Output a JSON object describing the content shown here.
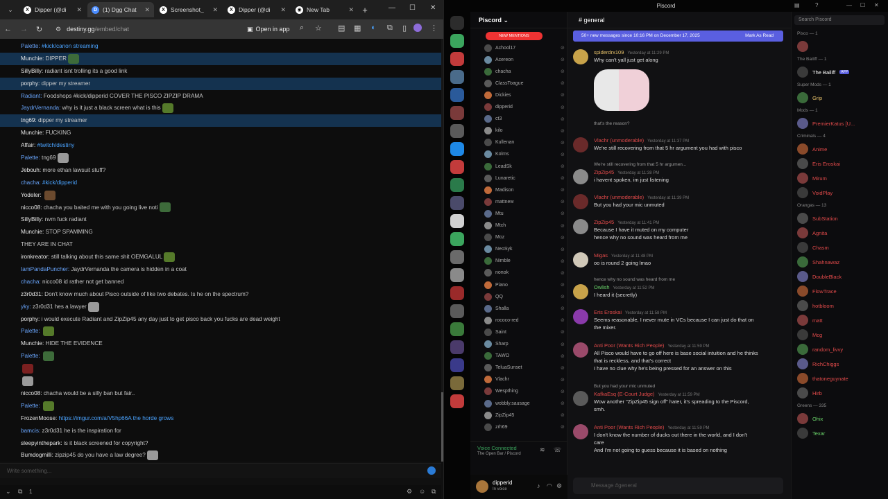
{
  "browser": {
    "tabs": [
      {
        "label": "Dipper (@di",
        "icon": "x-icon"
      },
      {
        "label": "(1) Dgg Chat",
        "icon": "dgg-icon"
      },
      {
        "label": "Screenshot_",
        "icon": "x-icon"
      },
      {
        "label": "Dipper (@di",
        "icon": "x-icon"
      },
      {
        "label": "New Tab",
        "icon": "globe-icon"
      }
    ],
    "url_host": "destiny.gg",
    "url_path": "/embed/chat",
    "open_in_app": "Open in app"
  },
  "chat": {
    "messages": [
      {
        "user": "Palette:",
        "text": "#kick/canon streaming",
        "link": true,
        "hl": false,
        "blue": true
      },
      {
        "user": "Munchie:",
        "text": "DIPPER",
        "hl": true
      },
      {
        "user": "SillyBilly:",
        "text": "radiant isnt trolling its a good link",
        "hl": false
      },
      {
        "user": "porphy:",
        "text": "dipper my streamer",
        "hl": true
      },
      {
        "user": "Radiant:",
        "text": "Foodshops #kick/dipperid COVER THE PISCO ZIPZIP DRAMA",
        "hl": false,
        "blue": true
      },
      {
        "user": "JaydrVernanda:",
        "text": "why is it just a black screen what is this",
        "hl": false,
        "blue": true
      },
      {
        "user": "tng69:",
        "text": "dipper my streamer",
        "hl": true
      },
      {
        "user": "Munchie:",
        "text": "FUCKING",
        "hl": false
      },
      {
        "user": "Affair:",
        "text": "#twitch/destiny",
        "hl": false,
        "link": true
      },
      {
        "user": "Palette:",
        "text": "tng69",
        "hl": false,
        "blue": true
      },
      {
        "user": "Jebouh:",
        "text": "more ethan lawsuit stuff?",
        "hl": false
      },
      {
        "user": "chacha:",
        "text": "#kick/dipperid",
        "hl": false,
        "link": true,
        "blue": true
      },
      {
        "user": "Yodeler:",
        "text": "",
        "hl": false
      },
      {
        "user": "nicco08:",
        "text": "chacha  you baited me with you going live noti",
        "hl": false
      },
      {
        "user": "SillyBilly:",
        "text": "nvm fuck radiant",
        "hl": false
      },
      {
        "user": "Munchie:",
        "text": "STOP SPAMMING",
        "hl": false
      },
      {
        "user": "",
        "text": "THEY ARE IN CHAT",
        "hl": false
      },
      {
        "user": "ironkreator:",
        "text": "still talking about this same shit OEMGALUL",
        "hl": false
      },
      {
        "user": "IamPandaPuncher:",
        "text": "JaydrVernanda the camera is hidden in a coat",
        "hl": false,
        "blue": true
      },
      {
        "user": "chacha:",
        "text": "nicco08 id rather not get banned",
        "hl": false,
        "blue": true
      },
      {
        "user": "z3r0d31:",
        "text": "Don't know much about Pisco outside of like two debates. Is he on the spectrum?",
        "hl": false
      },
      {
        "user": "yky:",
        "text": "z3r0d31 hes a lawyer",
        "hl": false,
        "blue": true
      },
      {
        "user": "porphy:",
        "text": "i would execute Radiant and ZipZip45 any day just to get pisco back you fucks are dead weight",
        "hl": false
      },
      {
        "user": "Palette:",
        "text": "",
        "hl": false,
        "blue": true
      },
      {
        "user": "Munchie:",
        "text": "HIDE THE EVIDENCE",
        "hl": false
      },
      {
        "user": "Palette:",
        "text": "",
        "hl": false,
        "blue": true
      },
      {
        "user": "",
        "text": "",
        "hl": false
      },
      {
        "user": "",
        "text": "",
        "hl": false
      },
      {
        "user": "nicco08:",
        "text": "chacha  would be a silly ban but fair..",
        "hl": false
      },
      {
        "user": "Palette:",
        "text": "",
        "hl": false,
        "blue": true
      },
      {
        "user": "FrozenMoose:",
        "text": "https://imgur.com/a/V5hp66A the horde grows",
        "hl": false,
        "link": true
      },
      {
        "user": "bamcis:",
        "text": "z3r0d31 he is the inspiration for",
        "hl": false,
        "blue": true
      },
      {
        "user": "sleepyinthepark:",
        "text": "is it black screened for copyright?",
        "hl": false
      },
      {
        "user": "Bumdogmilli:",
        "text": "zipzip45 do you have a law degree?",
        "hl": false
      }
    ],
    "input_placeholder": "Write something...",
    "footer_count": "1"
  },
  "discord": {
    "window_title": "Piscord",
    "server_name": "Piscord",
    "channel": "general",
    "new_messages": "50+ new messages since 10:16 PM on December 17, 2025",
    "mark_as_read": "Mark As Read",
    "voice_members": [
      "Achool17",
      "Acereon",
      "chacha",
      "ClassToague",
      "Dickies",
      "dipperid",
      "ct3",
      "kilo",
      "Kullenan",
      "Kolms",
      "LeadSk",
      "Lunaretic",
      "Madison",
      "mattnew",
      "Mtu",
      "Mtch",
      "Moz",
      "NeoSyk",
      "Nimble",
      "nonok",
      "Piano",
      "QQ",
      "Shalla",
      "rococo-red",
      "Saint",
      "Sharp",
      "TAWO",
      "TeluaSunset",
      "Vlachr",
      "Wespthing",
      "wobbly.sausage",
      "ZipZip45",
      "zrh69"
    ],
    "voice_status": "Voice Connected",
    "voice_channel": "The Open Bar / Piscord",
    "username": "dipperid",
    "user_status": "In voice",
    "composer_placeholder": "Message #general",
    "member_search": "Search Piscord",
    "messages": [
      {
        "name": "spiderdrx109",
        "time": "Yesterday at 11:29 PM",
        "text": "Why can't yall just get along",
        "color": "#e8c36b"
      },
      {
        "name": "",
        "time": "",
        "text": "",
        "reply": "that's the reason?",
        "color": "#e24a4a"
      },
      {
        "name": "Vlachr (unmoderable)",
        "time": "Yesterday at 11:37 PM",
        "text": "We're still recovering from that 5 hr argument you had with pisco",
        "color": "#e24a4a"
      },
      {
        "name": "ZipZip45",
        "time": "Yesterday at 11:38 PM",
        "text": "i havent spoken, im just listening",
        "reply": "We're still recovering from that 5 hr argumen...",
        "color": "#e24a4a"
      },
      {
        "name": "Vlachr (unmoderable)",
        "time": "Yesterday at 11:39 PM",
        "text": "But you had your mic unmuted",
        "color": "#e24a4a"
      },
      {
        "name": "ZipZip45",
        "time": "Yesterday at 11:41 PM",
        "text": "Because I have it muted on my computer",
        "text2": "hence why no sound was heard from me",
        "color": "#e24a4a"
      },
      {
        "name": "Migas",
        "time": "Yesterday at 11:48 PM",
        "text": "oo is round 2 going lmao",
        "color": "#e24a4a"
      },
      {
        "name": "Owlish",
        "time": "Yesterday at 11:52 PM",
        "text": "I heard it (secretly)",
        "reply": "hence why no sound was heard from me",
        "color": "#6ad46a"
      },
      {
        "name": "Eris Eroskai",
        "time": "Yesterday at 11:58 PM",
        "text": "Seems reasonable, I never mute in VCs because I can just do that on",
        "text2": "the mixer.",
        "color": "#e24a4a"
      },
      {
        "name": "Anti Poor (Wants Rich People)",
        "time": "Yesterday at 11:59 PM",
        "text": "All Pisco would have to go off here is base social intuition and he thinks",
        "text2": "that is reckless, and that's correct",
        "text3": "I have no clue why he's being pressed for an answer on this",
        "color": "#e24a4a"
      },
      {
        "name": "KafkaEsq (E-Court Judge)",
        "time": "Yesterday at 11:59 PM",
        "text": "Wow another \"ZipZip45 sign off\" hater, it's spreading to the Piscord,",
        "text2": "smh.",
        "reply": "But you had your mic unmuted",
        "color": "#e24a4a"
      },
      {
        "name": "Anti Poor (Wants Rich People)",
        "time": "Yesterday at 11:59 PM",
        "text": "I don't know the number of ducks out there in the world, and I don't",
        "text2": "care",
        "text3": "And I'm not going to guess because it is based on nothing",
        "color": "#e24a4a"
      }
    ],
    "member_groups": [
      {
        "title": "Pisco — 1",
        "members": [
          {
            "name": "",
            "color": "#e24a4a"
          }
        ]
      },
      {
        "title": "The Bailiff — 1",
        "members": [
          {
            "name": "The Bailiff",
            "color": "#ffffff",
            "badge": "APP"
          }
        ]
      },
      {
        "title": "Super Mods — 1",
        "members": [
          {
            "name": "Grip",
            "color": "#e8c36b"
          }
        ]
      },
      {
        "title": "Mods — 1",
        "members": [
          {
            "name": "PremierKatus [U...",
            "color": "#e24a4a"
          }
        ]
      },
      {
        "title": "Criminals — 4",
        "members": [
          {
            "name": "Anime",
            "color": "#e24a4a"
          },
          {
            "name": "Eris Eroskai",
            "color": "#e24a4a"
          },
          {
            "name": "Mirum",
            "color": "#e24a4a"
          },
          {
            "name": "VoidPlay",
            "color": "#e24a4a"
          }
        ]
      },
      {
        "title": "Orangas — 13",
        "members": [
          {
            "name": "SubStation",
            "color": "#e24a4a"
          },
          {
            "name": "Agnita",
            "color": "#e24a4a"
          },
          {
            "name": "Chasm",
            "color": "#e24a4a"
          },
          {
            "name": "Shahnawaz",
            "color": "#e24a4a"
          },
          {
            "name": "DoubleBlack",
            "color": "#e24a4a"
          },
          {
            "name": "FlowTrace",
            "color": "#e24a4a"
          },
          {
            "name": "hotbloom",
            "color": "#e24a4a"
          },
          {
            "name": "matt",
            "color": "#e24a4a"
          },
          {
            "name": "Mcg",
            "color": "#e24a4a"
          },
          {
            "name": "random_livvy",
            "color": "#e24a4a"
          },
          {
            "name": "RichChiggs",
            "color": "#e24a4a"
          },
          {
            "name": "thatoneguynate",
            "color": "#e24a4a"
          },
          {
            "name": "Hirb",
            "color": "#e24a4a"
          }
        ]
      },
      {
        "title": "Greens — 335",
        "members": [
          {
            "name": "Ohix",
            "color": "#6ad46a"
          },
          {
            "name": "Texar",
            "color": "#6ad46a"
          }
        ]
      }
    ]
  }
}
